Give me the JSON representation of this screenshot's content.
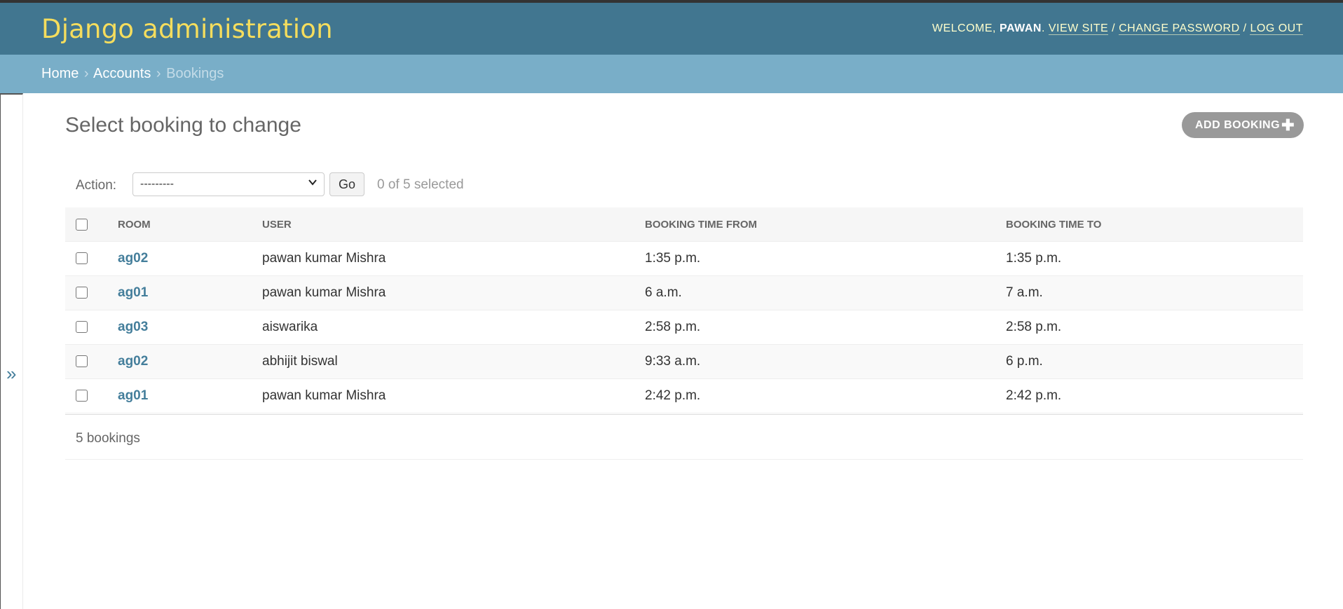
{
  "header": {
    "branding": "Django administration",
    "welcome": "WELCOME,",
    "username": "PAWAN",
    "view_site": "VIEW SITE",
    "change_password": "CHANGE PASSWORD",
    "log_out": "LOG OUT"
  },
  "breadcrumbs": {
    "home": "Home",
    "app": "Accounts",
    "current": "Bookings"
  },
  "main": {
    "title": "Select booking to change",
    "add_button": "ADD BOOKING",
    "action_label": "Action:",
    "action_selected": "---------",
    "go_label": "Go",
    "selected_count": "0 of 5 selected",
    "columns": [
      "ROOM",
      "USER",
      "BOOKING TIME FROM",
      "BOOKING TIME TO"
    ],
    "rows": [
      {
        "room": "ag02",
        "user": "pawan kumar Mishra",
        "from": "1:35 p.m.",
        "to": "1:35 p.m."
      },
      {
        "room": "ag01",
        "user": "pawan kumar Mishra",
        "from": "6 a.m.",
        "to": "7 a.m."
      },
      {
        "room": "ag03",
        "user": "aiswarika",
        "from": "2:58 p.m.",
        "to": "2:58 p.m."
      },
      {
        "room": "ag02",
        "user": "abhijit biswal",
        "from": "9:33 a.m.",
        "to": "6 p.m."
      },
      {
        "room": "ag01",
        "user": "pawan kumar Mishra",
        "from": "2:42 p.m.",
        "to": "2:42 p.m."
      }
    ],
    "result_count": "5 bookings"
  },
  "icons": {
    "sidebar_toggle": "double-chevron-right-icon",
    "add": "plus-icon",
    "select": "chevron-down-icon"
  },
  "colors": {
    "header_bg": "#417690",
    "branding": "#f5dd5d",
    "breadcrumbs_bg": "#79aec8",
    "link": "#447e9b"
  }
}
